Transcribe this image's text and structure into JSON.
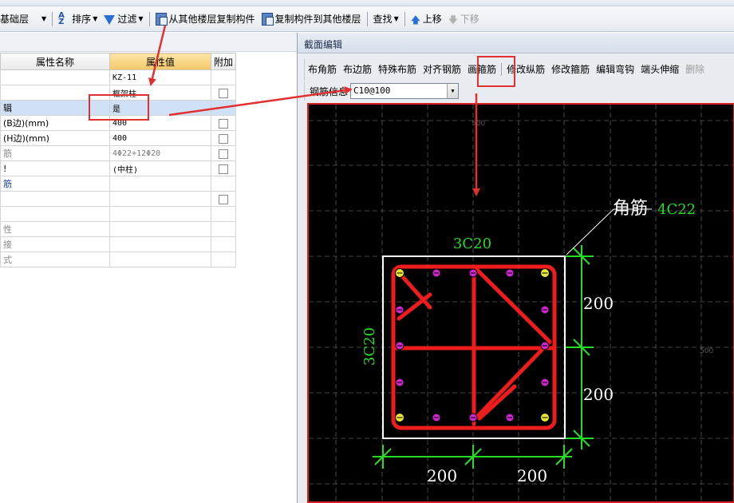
{
  "toolbar": {
    "floor_value": "基础层",
    "sort": "排序",
    "filter": "过滤",
    "copy_from_floor": "从其他楼层复制构件",
    "copy_to_floor": "复制构件到其他楼层",
    "find": "查找",
    "move_up": "上移",
    "move_down": "下移"
  },
  "table": {
    "headers": {
      "name": "属性名称",
      "value": "属性值",
      "extra": "附加"
    },
    "rows": [
      {
        "name": "",
        "value": "KZ-11",
        "checkbox": false
      },
      {
        "name": "",
        "value": "框架柱",
        "checkbox": true
      },
      {
        "name": "辑",
        "value": "是",
        "checkbox": false
      },
      {
        "name": "(B边)(mm)",
        "value": "400",
        "checkbox": true
      },
      {
        "name": "(H边)(mm)",
        "value": "400",
        "checkbox": true
      },
      {
        "name": "筋",
        "value": "4Φ22+12Φ20",
        "checkbox": true
      },
      {
        "name": "!",
        "value": "(中柱)",
        "checkbox": true
      },
      {
        "name": "筋",
        "value": "",
        "checkbox": false
      },
      {
        "name": "",
        "value": "",
        "checkbox": true
      },
      {
        "name": "",
        "value": "",
        "checkbox": false
      },
      {
        "name": "性",
        "value": "",
        "checkbox": false
      },
      {
        "name": "接",
        "value": "",
        "checkbox": false
      },
      {
        "name": "式",
        "value": "",
        "checkbox": false
      }
    ]
  },
  "editor": {
    "title": "截面编辑",
    "tools": [
      "布角筋",
      "布边筋",
      "特殊布筋",
      "对齐钢筋",
      "画箍筋",
      "修改纵筋",
      "修改箍筋",
      "编辑弯钩",
      "端头伸缩",
      "删除"
    ],
    "rebar_info_label": "钢筋信息",
    "rebar_info_value": "C10@100"
  },
  "drawing": {
    "corner_label": "角筋",
    "corner_value": "4C22",
    "top_edge_label": "3C20",
    "left_edge_label": "3C20",
    "dim_bottom": [
      "200",
      "200"
    ],
    "dim_right": [
      "200",
      "200"
    ],
    "grid_label_top": "500",
    "grid_label_right": "500"
  },
  "colors": {
    "stirrup": "#ee1c1c",
    "dimension": "#22dd22",
    "annotation": "#e23030",
    "corner_bar": "#e6e63a",
    "side_bar": "#d026d0",
    "column_outline": "#ffffff"
  }
}
